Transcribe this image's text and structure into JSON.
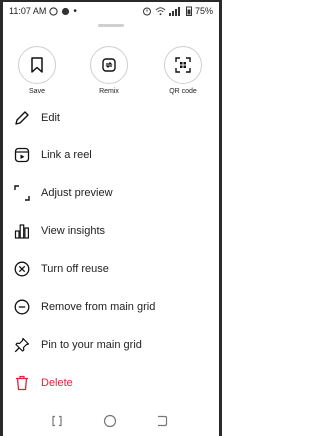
{
  "status_bar": {
    "time": "11:07 AM",
    "battery": "75%"
  },
  "actions": [
    {
      "label": "Save",
      "icon": "bookmark-icon"
    },
    {
      "label": "Remix",
      "icon": "remix-icon"
    },
    {
      "label": "QR code",
      "icon": "qr-code-icon"
    }
  ],
  "menu": [
    {
      "label": "Edit",
      "icon": "pencil-icon"
    },
    {
      "label": "Link a reel",
      "icon": "reel-icon"
    },
    {
      "label": "Adjust preview",
      "icon": "crop-corners-icon"
    },
    {
      "label": "View insights",
      "icon": "bar-chart-icon"
    },
    {
      "label": "Turn off reuse",
      "icon": "circle-x-icon"
    },
    {
      "label": "Remove from main grid",
      "icon": "circle-minus-icon"
    },
    {
      "label": "Pin to your main grid",
      "icon": "pin-icon"
    },
    {
      "label": "Delete",
      "icon": "trash-icon"
    }
  ],
  "colors": {
    "danger": "#e0223d",
    "border": "#cfcfcf"
  }
}
